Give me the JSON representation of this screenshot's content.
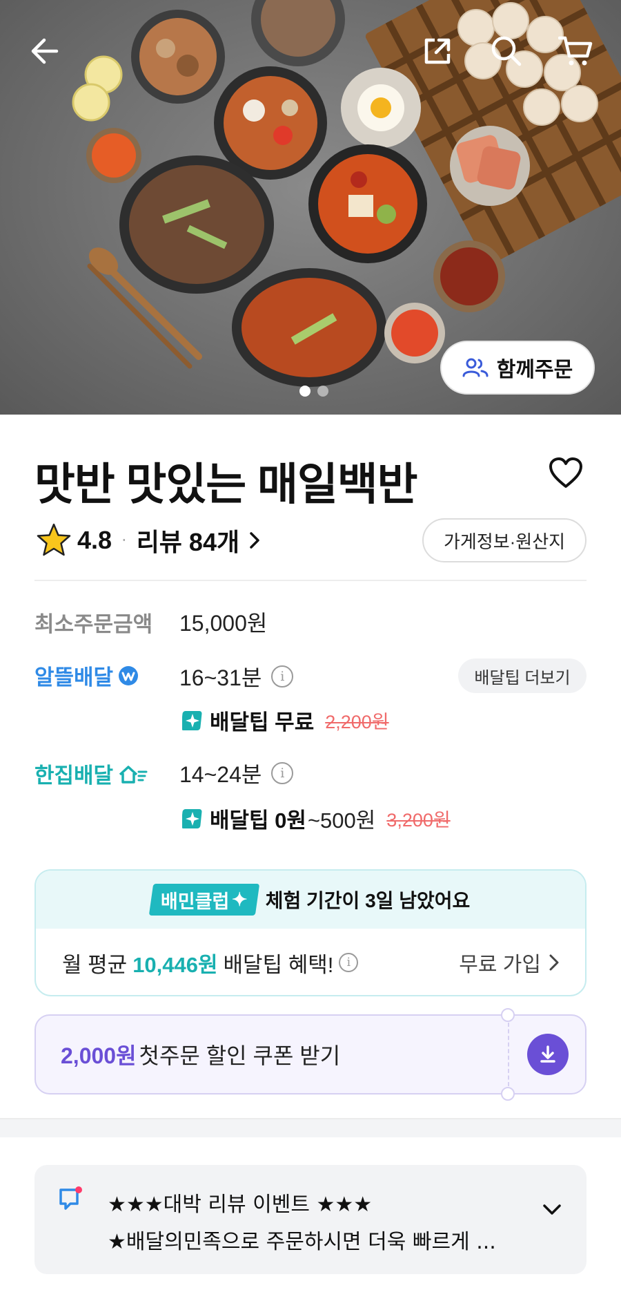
{
  "colors": {
    "teal": "#19b0b0",
    "blue": "#2f8ae6",
    "purple": "#6a4fd6",
    "strike_red": "#f06a6a"
  },
  "hero": {
    "together_order_label": "함께주문",
    "together_icon": "people-icon",
    "page_indicator": {
      "total": 2,
      "current": 1
    }
  },
  "store": {
    "name": "맛반  맛있는 매일백반",
    "rating": "4.8",
    "review_label": "리뷰 84개",
    "info_button_label": "가게정보·원산지"
  },
  "order": {
    "min_order_label": "최소주문금액",
    "min_order_value": "15,000원"
  },
  "delivery": {
    "economy": {
      "label": "알뜰배달",
      "time": "16~31분",
      "tip_label": "배달팁 무료",
      "tip_original": "2,200원",
      "tip_more_label": "배달팁 더보기"
    },
    "single": {
      "label": "한집배달",
      "time": "14~24분",
      "tip_label": "배달팁 0원",
      "tip_range": "~500원",
      "tip_original": "3,200원"
    }
  },
  "club": {
    "badge": "배민클럽",
    "trial_text": "체험 기간이 3일 남았어요",
    "benefit_prefix": "월 평균",
    "benefit_amount": "10,446원",
    "benefit_suffix": "배달팁 혜택!",
    "join_label": "무료 가입"
  },
  "coupon": {
    "amount": "2,000원",
    "text": "첫주문 할인 쿠폰 받기"
  },
  "notice": {
    "line1": "★★★대박 리뷰 이벤트 ★★★",
    "line2": "★배달의민족으로 주문하시면 더욱 빠르게 ..."
  }
}
